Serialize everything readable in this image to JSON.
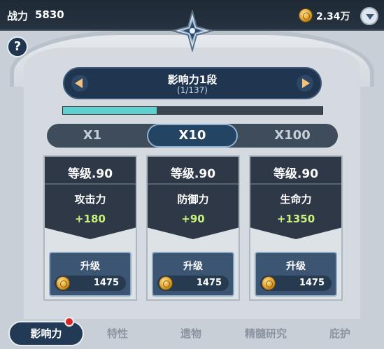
{
  "topbar": {
    "power_label": "战力",
    "power_value": "5830",
    "gold_value": "2.34万"
  },
  "help": {
    "label": "?"
  },
  "level": {
    "title": "影响力1段",
    "progress": "(1/137)",
    "xp_fill_fraction": 0.36
  },
  "multiplier": {
    "options": [
      "X1",
      "X10",
      "X100"
    ],
    "selected": "X10"
  },
  "cards": [
    {
      "level": "等级.90",
      "stat": "攻击力",
      "bonus": "+180",
      "button": "升级",
      "cost": "1475"
    },
    {
      "level": "等级.90",
      "stat": "防御力",
      "bonus": "+90",
      "button": "升级",
      "cost": "1475"
    },
    {
      "level": "等级.90",
      "stat": "生命力",
      "bonus": "+1350",
      "button": "升级",
      "cost": "1475"
    }
  ],
  "tabs": [
    "影响力",
    "特性",
    "遗物",
    "精髓研究",
    "庇护"
  ],
  "colors": {
    "accent_teal": "#5fd0cf",
    "bonus_green": "#c9f07a",
    "notification_red": "#d6262a"
  },
  "icons": [
    "coin-icon",
    "dropdown-icon",
    "help-icon",
    "arrow-left-icon",
    "arrow-right-icon",
    "emblem-icon"
  ]
}
